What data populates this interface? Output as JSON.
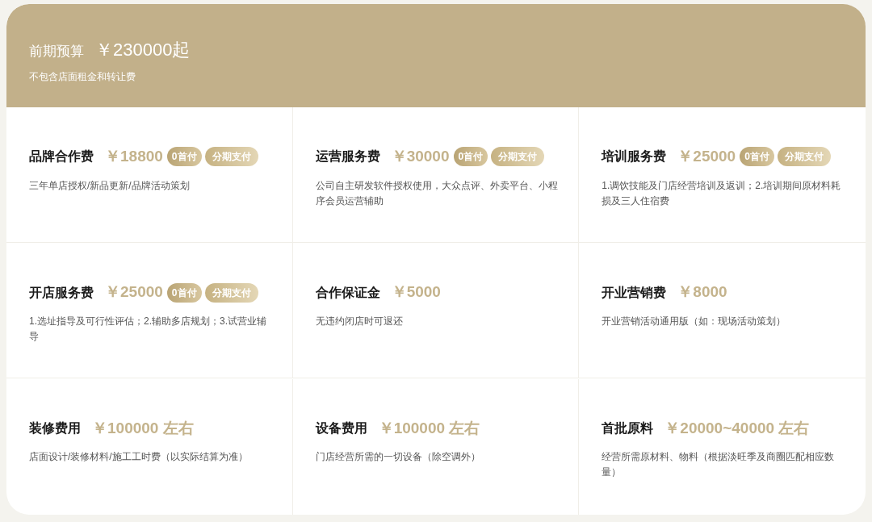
{
  "header": {
    "label": "前期预算",
    "amount": "￥230000起",
    "note": "不包含店面租金和转让费"
  },
  "items": [
    {
      "name": "品牌合作费",
      "price": "￥18800",
      "badges": [
        "0首付",
        "分期支付"
      ],
      "desc": "三年单店授权/新品更新/品牌活动策划"
    },
    {
      "name": "运营服务费",
      "price": "￥30000",
      "badges": [
        "0首付",
        "分期支付"
      ],
      "desc": "公司自主研发软件授权使用，大众点评、外卖平台、小程序会员运营辅助"
    },
    {
      "name": "培训服务费",
      "price": "￥25000",
      "badges": [
        "0首付",
        "分期支付"
      ],
      "desc": "1.调饮技能及门店经营培训及返训；2.培训期间原材料耗损及三人住宿费"
    },
    {
      "name": "开店服务费",
      "price": "￥25000",
      "badges": [
        "0首付",
        "分期支付"
      ],
      "desc": "1.选址指导及可行性评估；2.辅助多店规划；3.试营业辅导"
    },
    {
      "name": "合作保证金",
      "price": "￥5000",
      "desc": "无违约闭店时可退还"
    },
    {
      "name": "开业营销费",
      "price": "￥8000",
      "desc": "开业营销活动通用版（如：现场活动策划）"
    },
    {
      "name": "装修费用",
      "price": "￥100000 左右",
      "desc": "店面设计/装修材料/施工工时费（以实际结算为准）"
    },
    {
      "name": "设备费用",
      "price": "￥100000 左右",
      "desc": "门店经营所需的一切设备（除空调外）"
    },
    {
      "name": "首批原料",
      "price": "￥20000~40000 左右",
      "desc": "经营所需原材料、物料（根据淡旺季及商圈匹配相应数量）"
    }
  ]
}
